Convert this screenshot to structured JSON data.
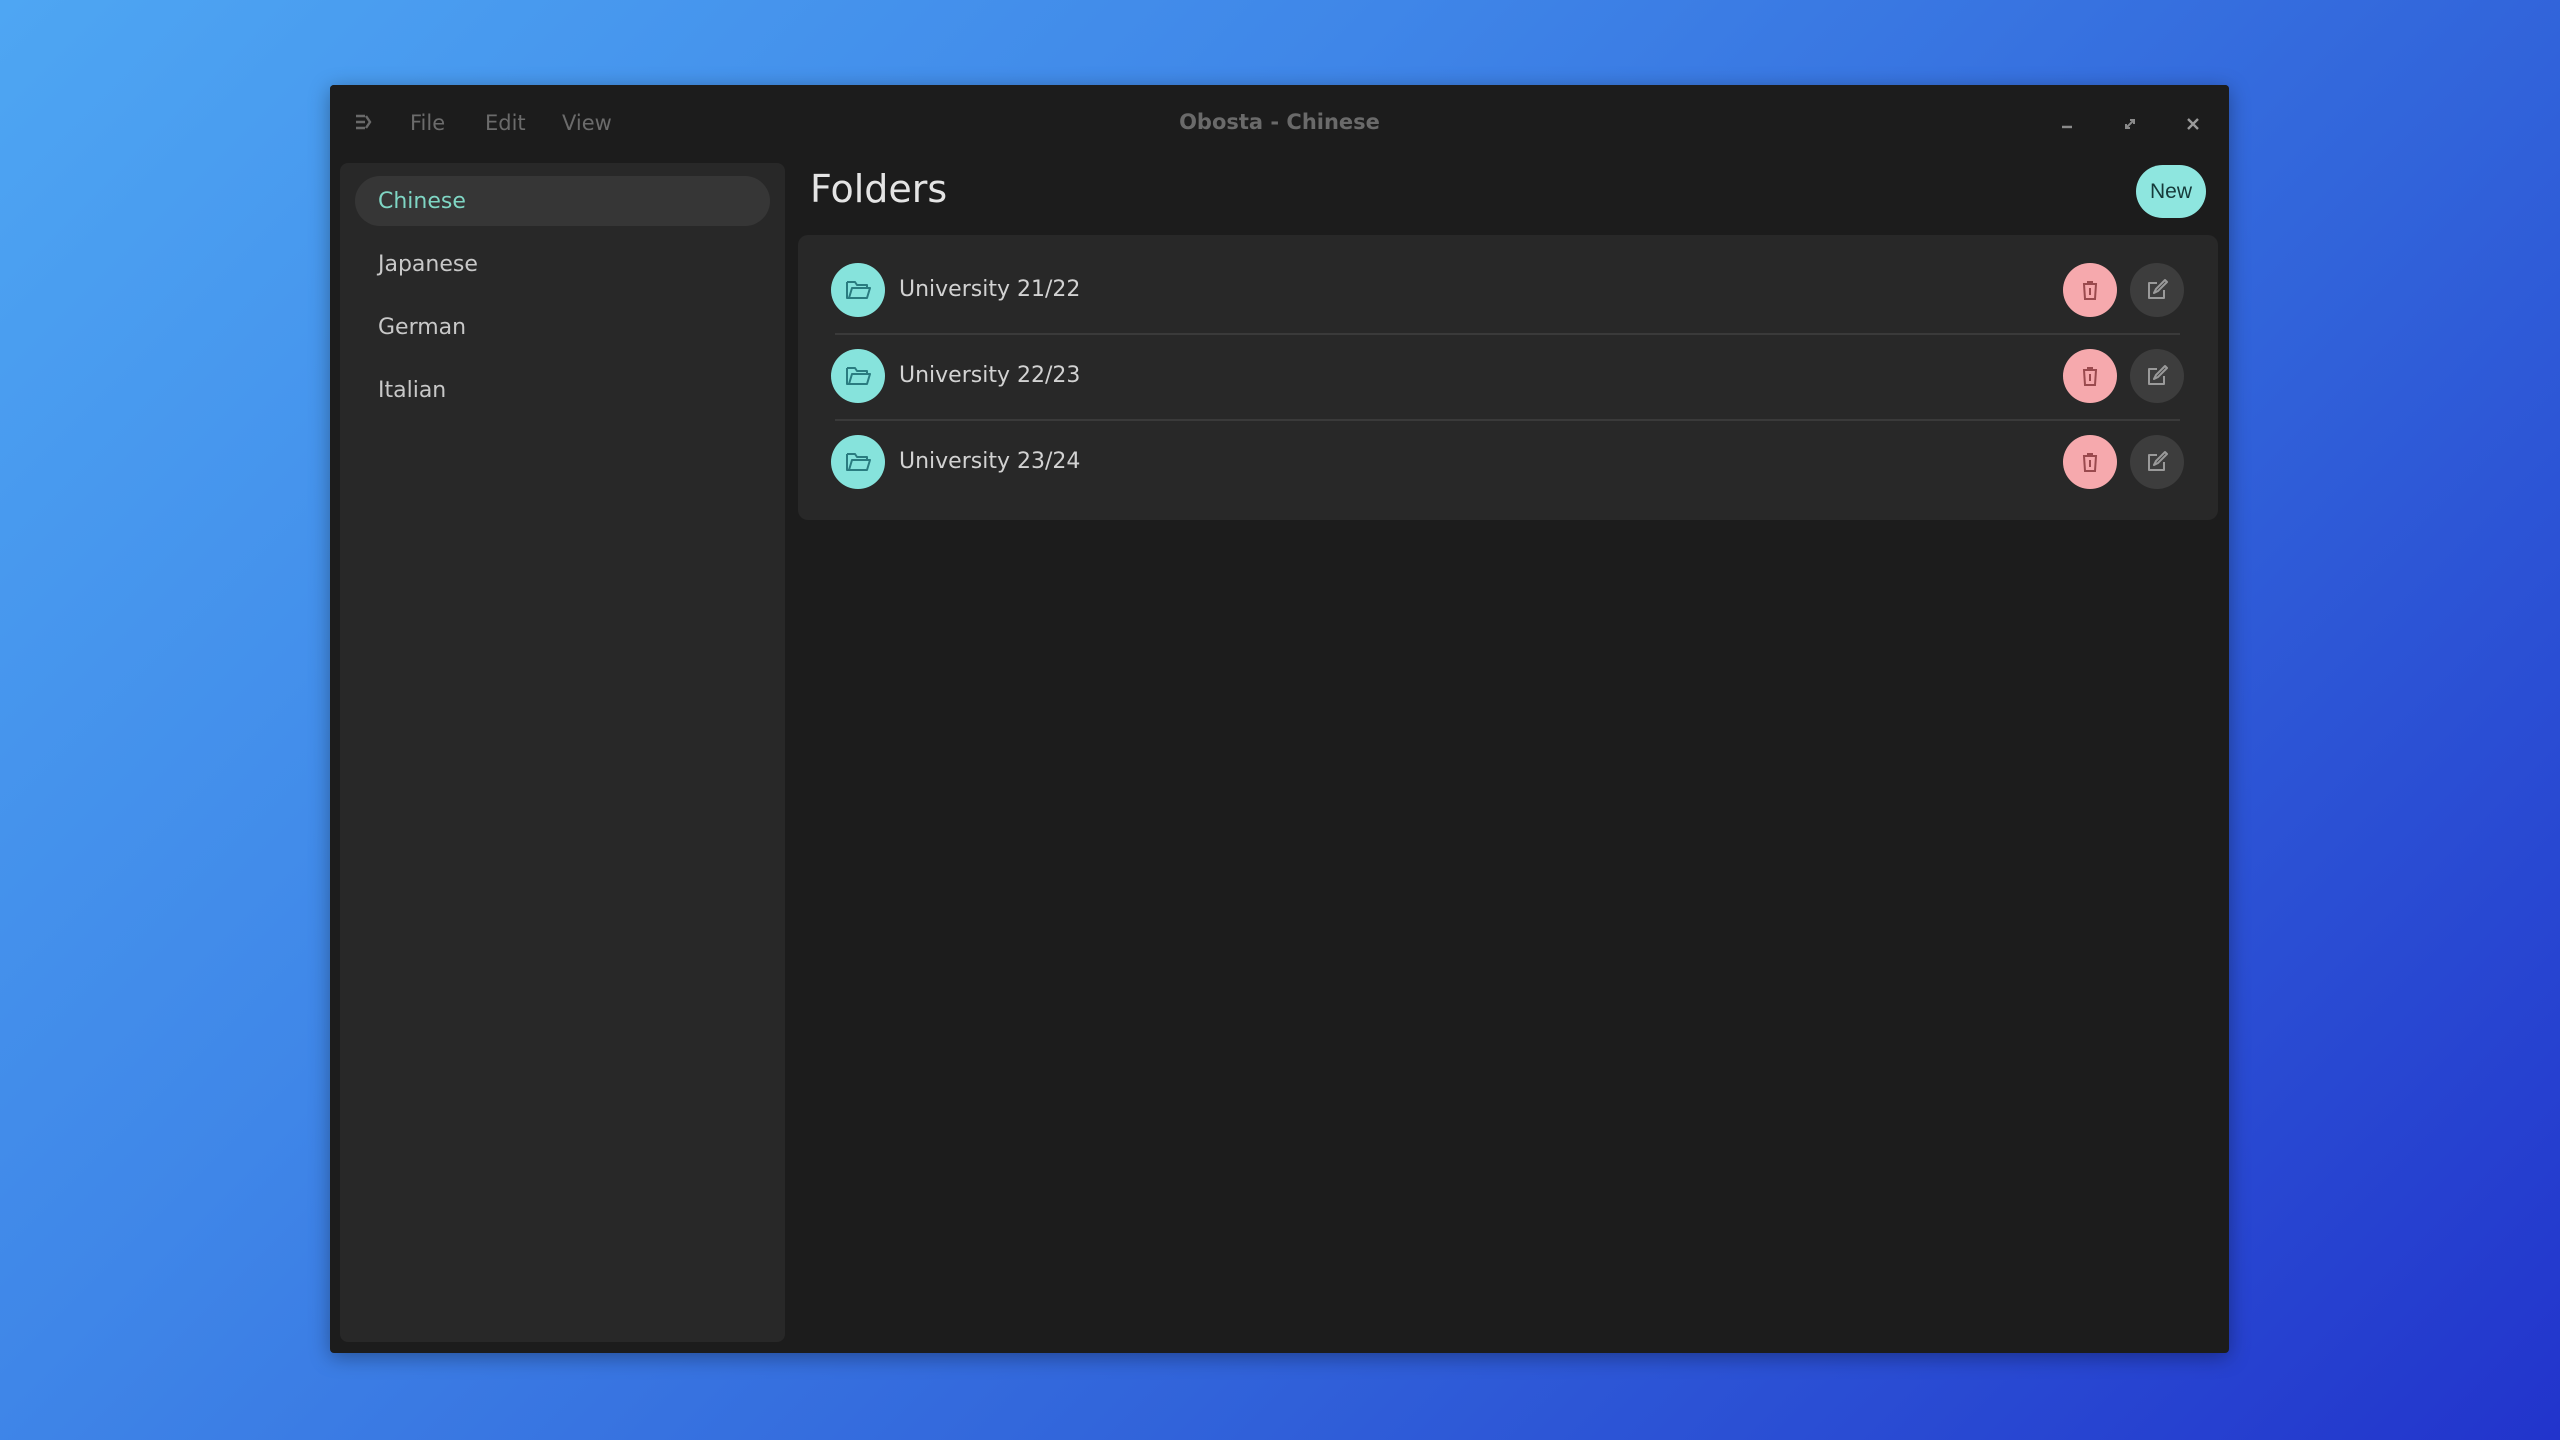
{
  "window": {
    "title": "Obosta - Chinese",
    "menu": [
      "File",
      "Edit",
      "View"
    ],
    "controls": [
      "minimize",
      "maximize",
      "close"
    ]
  },
  "sidebar": {
    "items": [
      {
        "label": "Chinese",
        "active": true
      },
      {
        "label": "Japanese",
        "active": false
      },
      {
        "label": "German",
        "active": false
      },
      {
        "label": "Italian",
        "active": false
      }
    ]
  },
  "main": {
    "title": "Folders",
    "new_label": "New",
    "folders": [
      {
        "name": "University 21/22"
      },
      {
        "name": "University 22/23"
      },
      {
        "name": "University 23/24"
      }
    ]
  },
  "colors": {
    "accent": "#86e3dc",
    "active_text": "#7fd6c4",
    "delete": "#f6a9ad",
    "edit": "#3d3d3d"
  },
  "icons": {
    "menu": "menu-icon",
    "folder": "folder-icon",
    "delete": "trash-icon",
    "edit": "edit-icon"
  }
}
